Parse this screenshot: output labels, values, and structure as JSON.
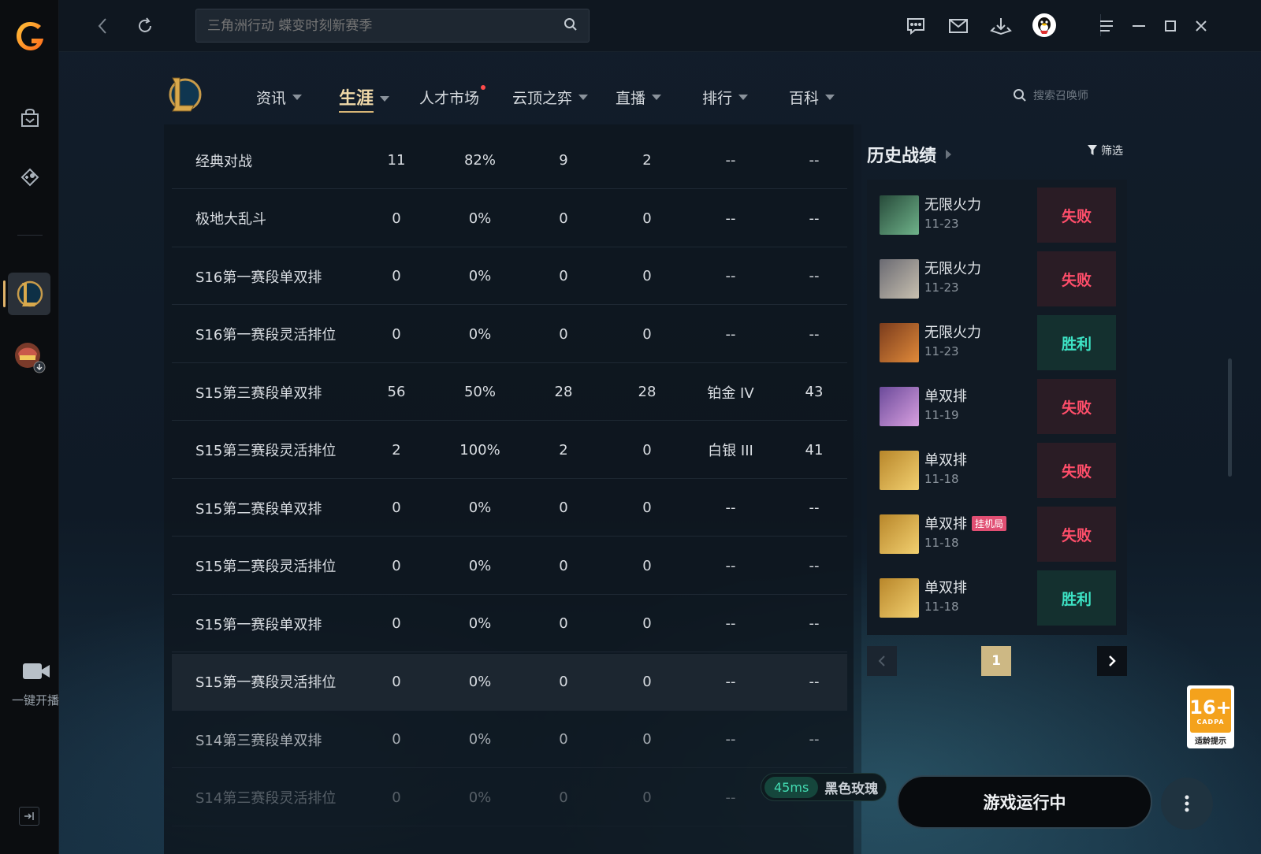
{
  "titlebar": {
    "search_placeholder": "三角洲行动 蝶变时刻新赛季"
  },
  "nav": {
    "items": [
      {
        "label": "资讯"
      },
      {
        "label": "生涯"
      },
      {
        "label": "人才市场"
      },
      {
        "label": "云顶之弈"
      },
      {
        "label": "直播"
      },
      {
        "label": "排行"
      },
      {
        "label": "百科"
      }
    ],
    "summoner_search_placeholder": "搜索召唤师"
  },
  "table": {
    "rows": [
      {
        "name": "经典对战",
        "games": "11",
        "winrate": "82%",
        "wins": "9",
        "losses": "2",
        "rank": "--",
        "points": "--"
      },
      {
        "name": "极地大乱斗",
        "games": "0",
        "winrate": "0%",
        "wins": "0",
        "losses": "0",
        "rank": "--",
        "points": "--"
      },
      {
        "name": "S16第一赛段单双排",
        "games": "0",
        "winrate": "0%",
        "wins": "0",
        "losses": "0",
        "rank": "--",
        "points": "--"
      },
      {
        "name": "S16第一赛段灵活排位",
        "games": "0",
        "winrate": "0%",
        "wins": "0",
        "losses": "0",
        "rank": "--",
        "points": "--"
      },
      {
        "name": "S15第三赛段单双排",
        "games": "56",
        "winrate": "50%",
        "wins": "28",
        "losses": "28",
        "rank": "铂金 IV",
        "points": "43"
      },
      {
        "name": "S15第三赛段灵活排位",
        "games": "2",
        "winrate": "100%",
        "wins": "2",
        "losses": "0",
        "rank": "白银 III",
        "points": "41"
      },
      {
        "name": "S15第二赛段单双排",
        "games": "0",
        "winrate": "0%",
        "wins": "0",
        "losses": "0",
        "rank": "--",
        "points": "--"
      },
      {
        "name": "S15第二赛段灵活排位",
        "games": "0",
        "winrate": "0%",
        "wins": "0",
        "losses": "0",
        "rank": "--",
        "points": "--"
      },
      {
        "name": "S15第一赛段单双排",
        "games": "0",
        "winrate": "0%",
        "wins": "0",
        "losses": "0",
        "rank": "--",
        "points": "--"
      },
      {
        "name": "S15第一赛段灵活排位",
        "games": "0",
        "winrate": "0%",
        "wins": "0",
        "losses": "0",
        "rank": "--",
        "points": "--"
      },
      {
        "name": "S14第三赛段单双排",
        "games": "0",
        "winrate": "0%",
        "wins": "0",
        "losses": "0",
        "rank": "--",
        "points": "--"
      },
      {
        "name": "S14第三赛段灵活排位",
        "games": "0",
        "winrate": "0%",
        "wins": "0",
        "losses": "0",
        "rank": "--",
        "points": "--"
      }
    ]
  },
  "history": {
    "title": "历史战绩",
    "filter_label": "筛选",
    "matches": [
      {
        "mode": "无限火力",
        "date": "11-23",
        "result": "失败",
        "tag": ""
      },
      {
        "mode": "无限火力",
        "date": "11-23",
        "result": "失败",
        "tag": ""
      },
      {
        "mode": "无限火力",
        "date": "11-23",
        "result": "胜利",
        "tag": ""
      },
      {
        "mode": "单双排",
        "date": "11-19",
        "result": "失败",
        "tag": ""
      },
      {
        "mode": "单双排",
        "date": "11-18",
        "result": "失败",
        "tag": ""
      },
      {
        "mode": "单双排",
        "date": "11-18",
        "result": "失败",
        "tag": "挂机局"
      },
      {
        "mode": "单双排",
        "date": "11-18",
        "result": "胜利",
        "tag": ""
      }
    ],
    "page": "1"
  },
  "age_rating": {
    "value": "16+",
    "org": "CADPA",
    "label": "适龄提示"
  },
  "status": {
    "ping": "45ms",
    "server": "黑色玫瑰",
    "play_button": "游戏运行中"
  },
  "sidebar": {
    "live_label": "一键开播"
  },
  "colors": {
    "accent_gold": "#d8b676",
    "lose_red": "#ff4e6a",
    "win_teal": "#3de3c5",
    "ping_green": "#43dcb2"
  }
}
